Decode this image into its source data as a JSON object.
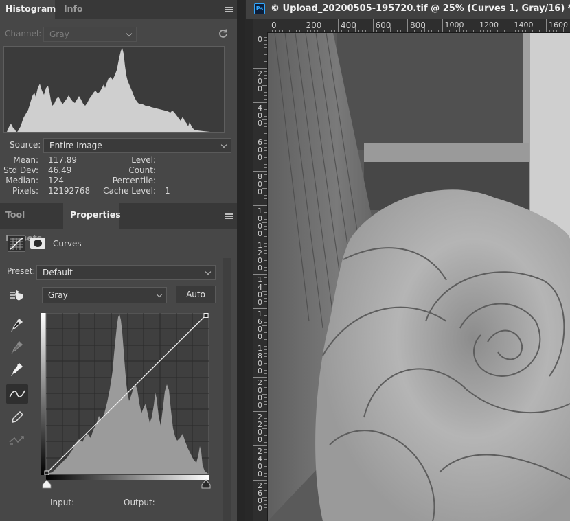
{
  "histogram_panel": {
    "tabs": [
      {
        "label": "Histogram",
        "active": true
      },
      {
        "label": "Info",
        "active": false
      }
    ],
    "channel_label": "Channel:",
    "channel_value": "Gray",
    "source_label": "Source:",
    "source_value": "Entire Image",
    "stats_left": [
      {
        "label": "Mean:",
        "value": "117.89"
      },
      {
        "label": "Std Dev:",
        "value": "46.49"
      },
      {
        "label": "Median:",
        "value": "124"
      },
      {
        "label": "Pixels:",
        "value": "12192768"
      }
    ],
    "stats_right": [
      {
        "label": "Level:",
        "value": ""
      },
      {
        "label": "Count:",
        "value": ""
      },
      {
        "label": "Percentile:",
        "value": ""
      },
      {
        "label": "Cache Level:",
        "value": "1"
      }
    ]
  },
  "properties_panel": {
    "tabs": [
      {
        "label": "Tool Presets",
        "active": false
      },
      {
        "label": "Properties",
        "active": true
      }
    ],
    "adjustment_title": "Curves",
    "preset_label": "Preset:",
    "preset_value": "Default",
    "channel_value": "Gray",
    "auto_label": "Auto",
    "input_label": "Input:",
    "output_label": "Output:",
    "tools": [
      "on-image-adjust-icon",
      "black-point-eyedropper-icon",
      "gray-point-eyedropper-icon",
      "white-point-eyedropper-icon",
      "curve-points-icon",
      "pencil-icon",
      "smooth-curve-icon"
    ]
  },
  "document": {
    "app_badge": "Ps",
    "title": "© Upload_20200505-195720.tif @ 25% (Curves 1, Gray/16) *",
    "h_ruler_labels": [
      "0",
      "200",
      "400",
      "600",
      "800",
      "1000",
      "1200",
      "1400",
      "1600"
    ],
    "v_ruler_labels": [
      "0",
      "200",
      "400",
      "600",
      "800",
      "1000",
      "1200",
      "1400",
      "1600",
      "1800",
      "2000",
      "2200",
      "2400",
      "2600"
    ]
  },
  "colors": {
    "panel": "#474747",
    "panel_dark": "#383838",
    "canvas_bg": "#282828",
    "histogram_fill": "#c9c9c9"
  }
}
